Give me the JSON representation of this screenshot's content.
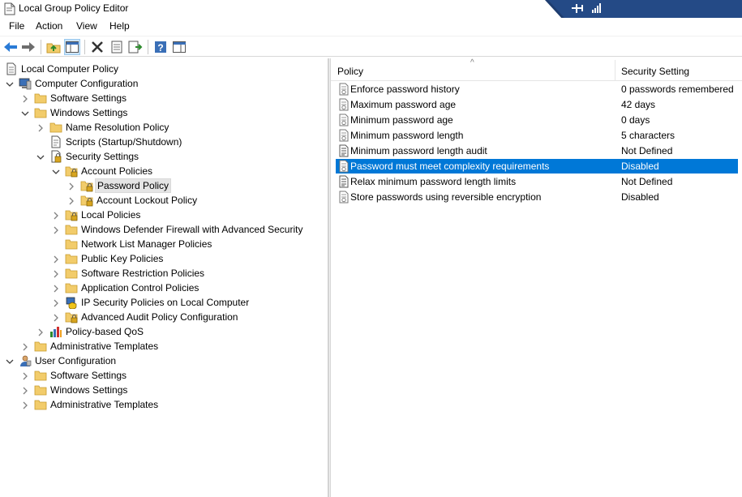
{
  "window": {
    "title": "Local Group Policy Editor"
  },
  "menu": [
    "File",
    "Action",
    "View",
    "Help"
  ],
  "toolbar": [
    "back-icon",
    "forward-icon",
    "up-folder-icon",
    "show-hide-tree-icon",
    "delete-icon",
    "properties-icon",
    "export-list-icon",
    "help-icon",
    "show-hide-action-pane-icon"
  ],
  "tree": [
    {
      "label": "Local Computer Policy",
      "icon": "policy-doc-icon",
      "arrow": ""
    },
    {
      "label": "Computer Configuration",
      "icon": "computer-icon",
      "arrow": "expanded"
    },
    {
      "label": "Software Settings",
      "icon": "folder-icon",
      "arrow": "collapsed"
    },
    {
      "label": "Windows Settings",
      "icon": "folder-icon",
      "arrow": "expanded"
    },
    {
      "label": "Name Resolution Policy",
      "icon": "folder-icon",
      "arrow": "collapsed"
    },
    {
      "label": "Scripts (Startup/Shutdown)",
      "icon": "script-icon",
      "arrow": ""
    },
    {
      "label": "Security Settings",
      "icon": "security-settings-icon",
      "arrow": "expanded"
    },
    {
      "label": "Account Policies",
      "icon": "lock-folder-icon",
      "arrow": "expanded"
    },
    {
      "label": "Password Policy",
      "icon": "lock-folder-icon",
      "arrow": "collapsed"
    },
    {
      "label": "Account Lockout Policy",
      "icon": "lock-folder-icon",
      "arrow": "collapsed"
    },
    {
      "label": "Local Policies",
      "icon": "lock-folder-icon",
      "arrow": "collapsed"
    },
    {
      "label": "Windows Defender Firewall with Advanced Security",
      "icon": "folder-icon",
      "arrow": "collapsed"
    },
    {
      "label": "Network List Manager Policies",
      "icon": "folder-icon",
      "arrow": ""
    },
    {
      "label": "Public Key Policies",
      "icon": "folder-icon",
      "arrow": "collapsed"
    },
    {
      "label": "Software Restriction Policies",
      "icon": "folder-icon",
      "arrow": "collapsed"
    },
    {
      "label": "Application Control Policies",
      "icon": "folder-icon",
      "arrow": "collapsed"
    },
    {
      "label": "IP Security Policies on Local Computer",
      "icon": "ip-security-icon",
      "arrow": "collapsed"
    },
    {
      "label": "Advanced Audit Policy Configuration",
      "icon": "lock-folder-icon",
      "arrow": "collapsed"
    },
    {
      "label": "Policy-based QoS",
      "icon": "qos-chart-icon",
      "arrow": "collapsed"
    },
    {
      "label": "Administrative Templates",
      "icon": "folder-icon",
      "arrow": "collapsed"
    },
    {
      "label": "User Configuration",
      "icon": "user-icon",
      "arrow": "expanded"
    },
    {
      "label": "Software Settings",
      "icon": "folder-icon",
      "arrow": "collapsed"
    },
    {
      "label": "Windows Settings",
      "icon": "folder-icon",
      "arrow": "collapsed"
    },
    {
      "label": "Administrative Templates",
      "icon": "folder-icon",
      "arrow": "collapsed"
    }
  ],
  "tree_selected": "Password Policy",
  "list": {
    "columns": [
      "Policy",
      "Security Setting"
    ],
    "rows": [
      {
        "name": "Enforce password history",
        "value": "0 passwords remembered",
        "icon": "policy-setting-icon"
      },
      {
        "name": "Maximum password age",
        "value": "42 days",
        "icon": "policy-setting-icon"
      },
      {
        "name": "Minimum password age",
        "value": "0 days",
        "icon": "policy-setting-icon"
      },
      {
        "name": "Minimum password length",
        "value": "5 characters",
        "icon": "policy-setting-icon"
      },
      {
        "name": "Minimum password length audit",
        "value": "Not Defined",
        "icon": "policy-text-icon"
      },
      {
        "name": "Password must meet complexity requirements",
        "value": "Disabled",
        "icon": "policy-setting-icon"
      },
      {
        "name": "Relax minimum password length limits",
        "value": "Not Defined",
        "icon": "policy-text-icon"
      },
      {
        "name": "Store passwords using reversible encryption",
        "value": "Disabled",
        "icon": "policy-setting-icon"
      }
    ],
    "selected": "Password must meet complexity requirements"
  },
  "colors": {
    "selection": "#0078d7",
    "title_accent": "#1e3d6f",
    "folder": "#f2cc6b"
  }
}
